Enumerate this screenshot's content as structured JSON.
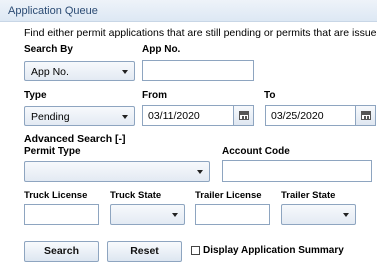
{
  "header": {
    "title": "Application Queue"
  },
  "intro": "Find either permit applications that are still pending or permits that are issued.",
  "search_by": {
    "label": "Search By",
    "value": "App No."
  },
  "app_no": {
    "label": "App No.",
    "value": ""
  },
  "type": {
    "label": "Type",
    "value": "Pending"
  },
  "from": {
    "label": "From",
    "value": "03/11/2020"
  },
  "to": {
    "label": "To",
    "value": "03/25/2020"
  },
  "advanced": {
    "label": "Advanced Search [-]"
  },
  "permit_type": {
    "label": "Permit Type",
    "value": ""
  },
  "account_code": {
    "label": "Account Code",
    "value": ""
  },
  "truck_license": {
    "label": "Truck License",
    "value": ""
  },
  "truck_state": {
    "label": "Truck State",
    "value": ""
  },
  "trailer_license": {
    "label": "Trailer License",
    "value": ""
  },
  "trailer_state": {
    "label": "Trailer State",
    "value": ""
  },
  "buttons": {
    "search": "Search",
    "reset": "Reset"
  },
  "summary": {
    "label": "Display Application Summary",
    "checked": false
  },
  "icons": {
    "calendar": "calendar-icon",
    "dropdown": "chevron-down-icon"
  }
}
